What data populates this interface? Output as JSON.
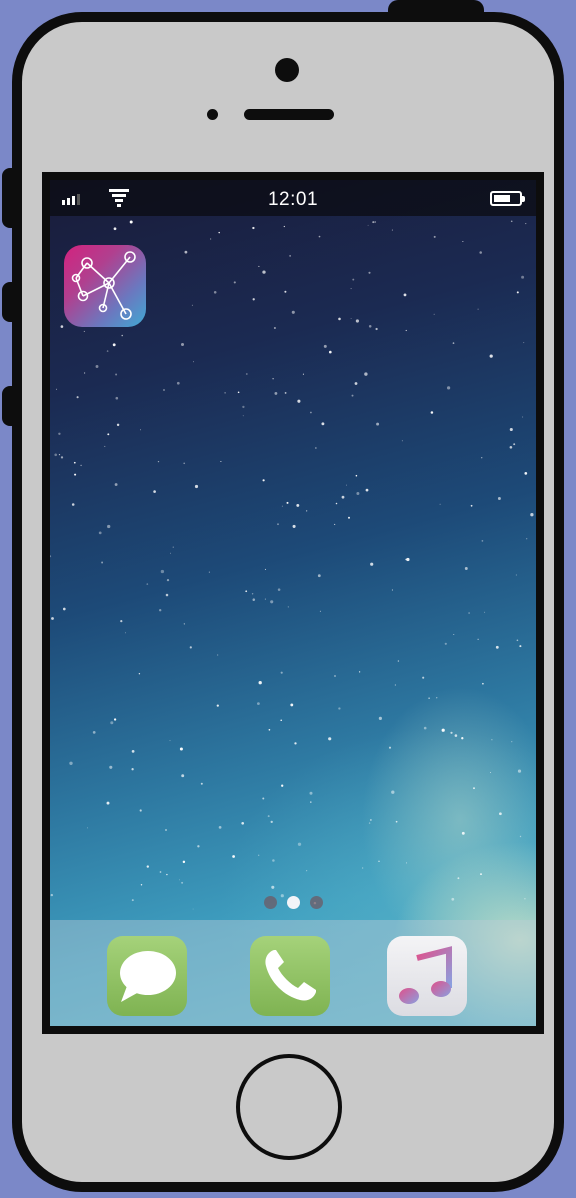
{
  "device": {
    "body_color": "#c9c9c9",
    "frame_color": "#0d0d0d",
    "background_color": "#7b88c8"
  },
  "status_bar": {
    "time": "12:01",
    "signal_icon": "cellular-signal-icon",
    "wifi_icon": "wifi-icon",
    "battery_icon": "battery-icon",
    "battery_level": 0.55
  },
  "home_screen": {
    "apps": [
      {
        "icon": "network-graph-app-icon",
        "colors": [
          "#d3227e",
          "#3fa9d3"
        ]
      }
    ],
    "page_indicator": {
      "pages": 3,
      "current": 2
    }
  },
  "dock": {
    "apps": [
      {
        "icon": "messages-icon",
        "color": "#8cc15e"
      },
      {
        "icon": "phone-icon",
        "color": "#8cc15e"
      },
      {
        "icon": "music-icon",
        "color": "#ececf0"
      }
    ]
  }
}
